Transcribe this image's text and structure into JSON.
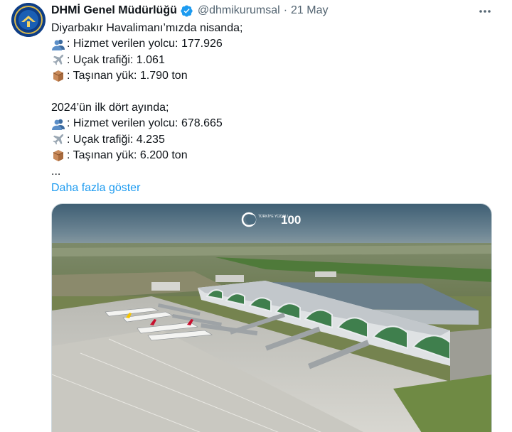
{
  "author": {
    "display_name": "DHMİ Genel Müdürlüğü",
    "handle": "@dhmikurumsal",
    "separator": "·",
    "date": "21 May",
    "avatar_icon": "dhmi-logo-icon",
    "verified_icon": "verified-badge-icon",
    "more_icon": "more-options-icon"
  },
  "tweet": {
    "line1": "Diyarbakır Havalimanı’mızda nisanda;",
    "line2": ": Hizmet verilen yolcu: 177.926",
    "line3": ": Uçak trafiği: 1.061",
    "line4": ": Taşınan yük: 1.790 ton",
    "line5": "2024’ün ilk dört ayında;",
    "line6": ": Hizmet verilen yolcu: 678.665",
    "line7": ": Uçak trafiği: 4.235",
    "line8": ": Taşınan yük: 6.200 ton",
    "line9": "...",
    "show_more": "Daha fazla göster",
    "emoji_passenger": "busts-in-silhouette-icon",
    "emoji_plane": "airplane-icon",
    "emoji_cargo": "package-icon"
  },
  "media": {
    "watermark_left": "TÜRKİYE YÜZYILI",
    "watermark_right": "100"
  },
  "colors": {
    "link": "#1d9bf0",
    "secondary_text": "#536471",
    "verified": "#1d9bf0"
  }
}
